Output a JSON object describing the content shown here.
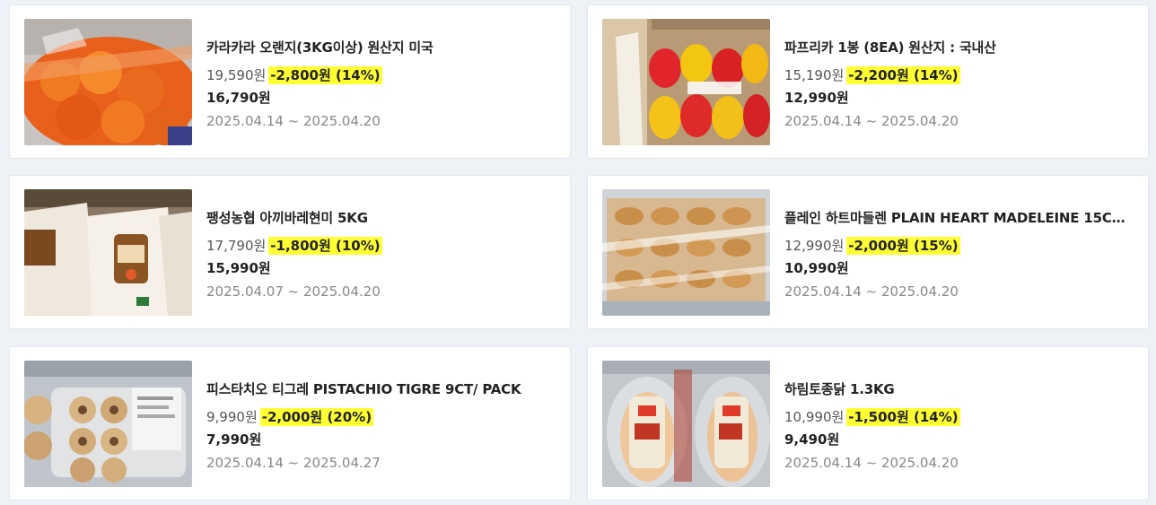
{
  "items": [
    {
      "name": "카라카라 오랜지(3KG이상) 원산지 미국",
      "original_price": "19,590원",
      "discount": "-2,800원 (14%)",
      "final_price": "16,790원",
      "period": "2025.04.14 ~ 2025.04.20",
      "image": "orange-bag-photo"
    },
    {
      "name": "파프리카 1봉 (8EA) 원산지 : 국내산",
      "original_price": "15,190원",
      "discount": "-2,200원 (14%)",
      "final_price": "12,990원",
      "period": "2025.04.14 ~ 2025.04.20",
      "image": "paprika-pack-photo"
    },
    {
      "name": "팽성농협 아끼바레현미 5KG",
      "original_price": "17,790원",
      "discount": "-1,800원 (10%)",
      "final_price": "15,990원",
      "period": "2025.04.07 ~ 2025.04.20",
      "image": "rice-bag-photo"
    },
    {
      "name": "플레인 하트마들렌 PLAIN HEART MADELEINE 15C…",
      "original_price": "12,990원",
      "discount": "-2,000원 (15%)",
      "final_price": "10,990원",
      "period": "2025.04.14 ~ 2025.04.20",
      "image": "madeleine-box-photo"
    },
    {
      "name": "피스타치오 티그레 PISTACHIO TIGRE 9CT/ PACK",
      "original_price": "9,990원",
      "discount": "-2,000원 (20%)",
      "final_price": "7,990원",
      "period": "2025.04.14 ~ 2025.04.27",
      "image": "pistachio-tigre-photo"
    },
    {
      "name": "하림토종닭 1.3KG",
      "original_price": "10,990원",
      "discount": "-1,500원 (14%)",
      "final_price": "9,490원",
      "period": "2025.04.14 ~ 2025.04.20",
      "image": "whole-chicken-photo"
    }
  ],
  "colors": {
    "discount_highlight": "#ffff33",
    "background": "#eef1f5"
  }
}
